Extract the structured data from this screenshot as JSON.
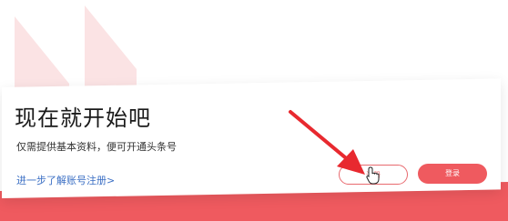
{
  "colors": {
    "accent": "#ef5a5f",
    "accent_light": "#fbe3e4",
    "link": "#3b6fc4",
    "annotation": "#e8292f"
  },
  "card": {
    "title": "现在就开始吧",
    "subtitle": "仅需提供基本资料，便可开通头条号",
    "learn_link": "进一步了解账号注册>"
  },
  "buttons": {
    "register_label": "注册",
    "login_label": "登录"
  },
  "icons": {
    "cursor": "hand-pointer-icon",
    "annotation": "red-arrow-icon"
  }
}
